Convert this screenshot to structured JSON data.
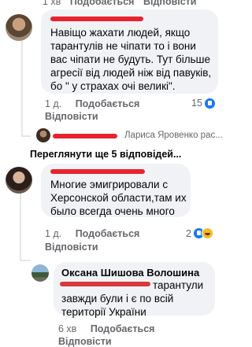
{
  "top": {
    "time": "1 хв",
    "reply": "Відповісти",
    "like": "Подобається"
  },
  "comment1": {
    "text": "Навіщо  жахати людей, якщо тарантулів не чіпати то і вони вас чіпати не будуть. Тут більше агресії від людей ніж від павуків, бо \" у страхах очі великі\".",
    "time": "1 д.",
    "like": "Подобається",
    "reply": "Відповісти",
    "reactions": "15"
  },
  "reply_preview": {
    "author": "Лариса Яровенко рас...",
    "more": "Переглянути ще 5 відповідей..."
  },
  "comment2": {
    "text": "Многие эмигрировали с Херсонской области,там их было всегда очень много",
    "time": "1 д.",
    "like": "Подобається",
    "reply": "Відповісти",
    "reactions": "2"
  },
  "comment3": {
    "author": "Оксана Шишова Волошина",
    "text": "тарантули завжди були і є по всій території України",
    "time": "6 хв",
    "like": "Подобається",
    "reply": "Відповісти"
  },
  "colors": {
    "like_blue": "#1877f2",
    "redact": "#e8232e",
    "bubble": "#f0f2f5"
  }
}
